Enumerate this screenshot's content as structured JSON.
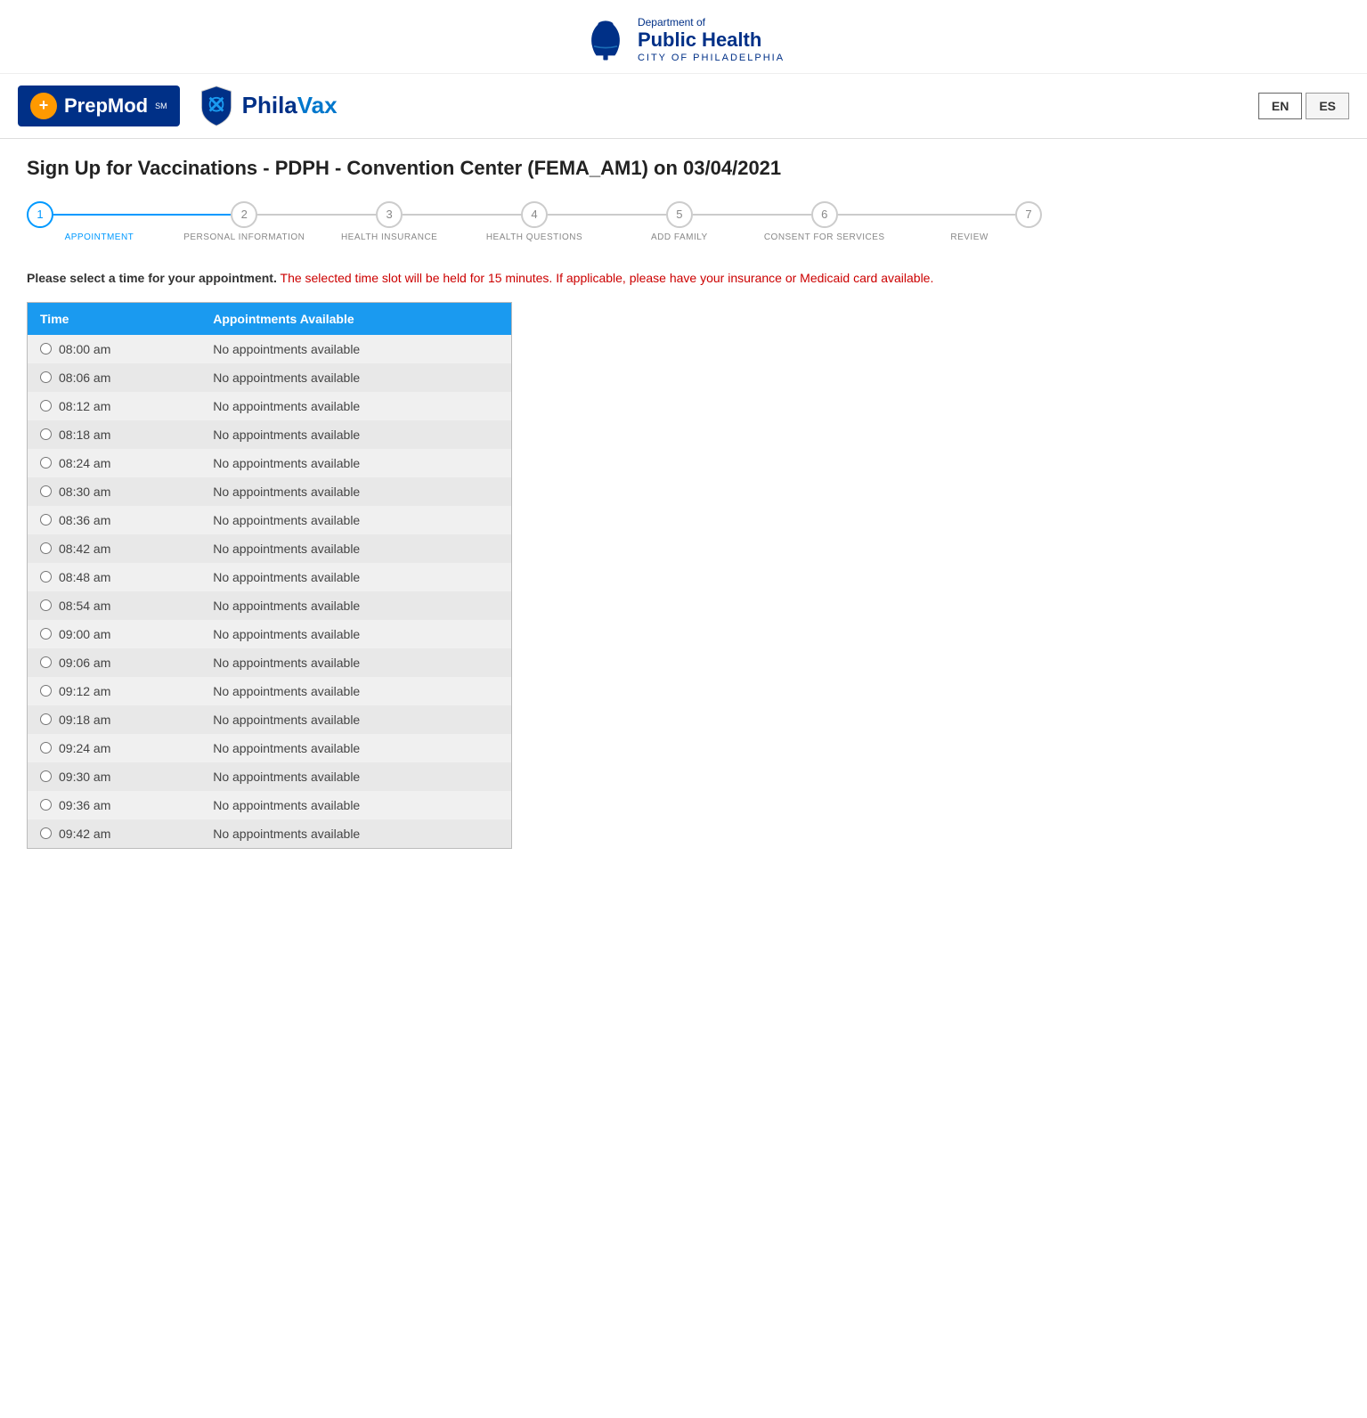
{
  "header": {
    "dept_of": "Department of",
    "dept_name": "Public Health",
    "city_name": "CITY OF PHILADELPHIA"
  },
  "brand": {
    "prepmod_label": "PrepMod",
    "prepmod_sm": "SM",
    "philavax_label_1": "Phila",
    "philavax_label_2": "Vax",
    "lang_en": "EN",
    "lang_es": "ES"
  },
  "page": {
    "title": "Sign Up for Vaccinations - PDPH - Convention Center (FEMA_AM1) on 03/04/2021"
  },
  "steps": [
    {
      "number": "1",
      "label": "APPOINTMENT",
      "active": true
    },
    {
      "number": "2",
      "label": "PERSONAL INFORMATION",
      "active": false
    },
    {
      "number": "3",
      "label": "HEALTH INSURANCE",
      "active": false
    },
    {
      "number": "4",
      "label": "HEALTH QUESTIONS",
      "active": false
    },
    {
      "number": "5",
      "label": "ADD FAMILY",
      "active": false
    },
    {
      "number": "6",
      "label": "CONSENT FOR SERVICES",
      "active": false
    },
    {
      "number": "7",
      "label": "REVIEW",
      "active": false
    }
  ],
  "instruction": {
    "main_text": "Please select a time for your appointment.",
    "warning_text": " The selected time slot will be held for 15 minutes. If applicable, please have your insurance or Medicaid card available."
  },
  "table": {
    "col_time": "Time",
    "col_appts": "Appointments Available",
    "rows": [
      {
        "time": "08:00 am",
        "availability": "No appointments available"
      },
      {
        "time": "08:06 am",
        "availability": "No appointments available"
      },
      {
        "time": "08:12 am",
        "availability": "No appointments available"
      },
      {
        "time": "08:18 am",
        "availability": "No appointments available"
      },
      {
        "time": "08:24 am",
        "availability": "No appointments available"
      },
      {
        "time": "08:30 am",
        "availability": "No appointments available"
      },
      {
        "time": "08:36 am",
        "availability": "No appointments available"
      },
      {
        "time": "08:42 am",
        "availability": "No appointments available"
      },
      {
        "time": "08:48 am",
        "availability": "No appointments available"
      },
      {
        "time": "08:54 am",
        "availability": "No appointments available"
      },
      {
        "time": "09:00 am",
        "availability": "No appointments available"
      },
      {
        "time": "09:06 am",
        "availability": "No appointments available"
      },
      {
        "time": "09:12 am",
        "availability": "No appointments available"
      },
      {
        "time": "09:18 am",
        "availability": "No appointments available"
      },
      {
        "time": "09:24 am",
        "availability": "No appointments available"
      },
      {
        "time": "09:30 am",
        "availability": "No appointments available"
      },
      {
        "time": "09:36 am",
        "availability": "No appointments available"
      },
      {
        "time": "09:42 am",
        "availability": "No appointments available"
      }
    ]
  },
  "colors": {
    "active_step": "#0099ff",
    "table_header_bg": "#1a9af0",
    "warning_text": "#cc0000",
    "dept_blue": "#003087"
  }
}
